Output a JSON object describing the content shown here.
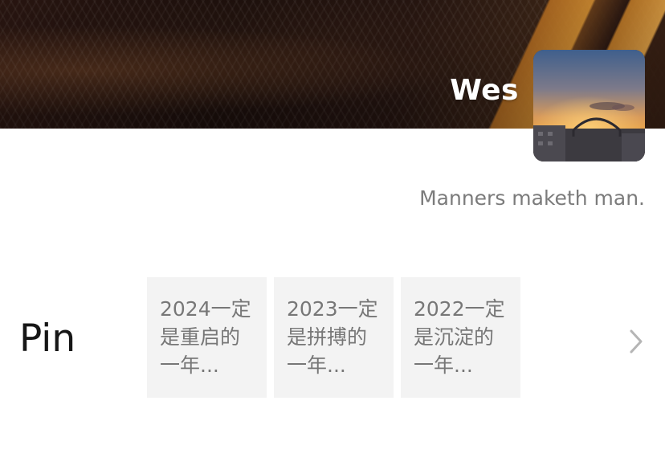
{
  "profile": {
    "nickname": "Wes",
    "signature": "Manners maketh man.",
    "avatar_icon": "sunset-avatar-icon"
  },
  "pinned": {
    "label": "Pin",
    "items": [
      {
        "text": "2024一定是重启的一年..."
      },
      {
        "text": "2023一定是拼搏的一年..."
      },
      {
        "text": "2022一定是沉淀的一年..."
      }
    ],
    "more_icon": "chevron-right-icon"
  },
  "colors": {
    "text_primary": "#161616",
    "text_secondary": "#7b7b7b",
    "card_background": "#f3f3f3",
    "chevron": "#b5b5b5"
  }
}
